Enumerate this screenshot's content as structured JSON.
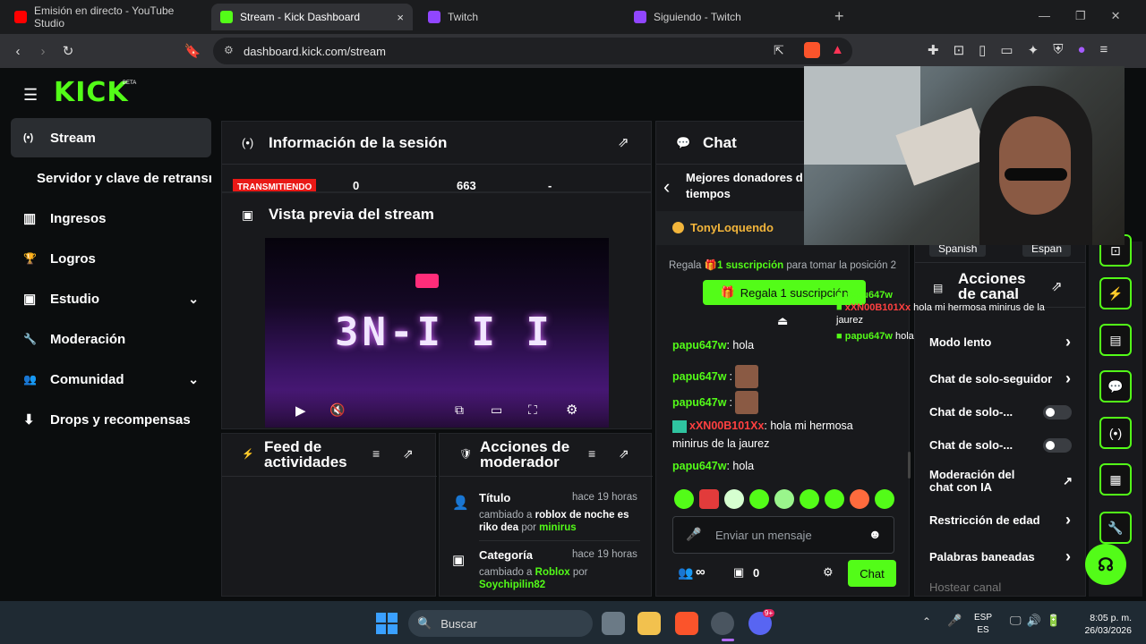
{
  "tabs": [
    {
      "title": "Emisión en directo - YouTube Studio",
      "favicon_color": "#ff0000"
    },
    {
      "title": "Stream - Kick Dashboard",
      "favicon_color": "#53fc18",
      "close": "×"
    },
    {
      "title": "Twitch",
      "favicon_color": "#9146ff"
    },
    {
      "title": "Siguiendo - Twitch",
      "favicon_color": "#9146ff"
    }
  ],
  "new_tab": "+",
  "address": {
    "url": "dashboard.kick.com/stream"
  },
  "logo": {
    "text": "KICK",
    "badge": "BETA"
  },
  "sidebar": [
    {
      "label": "Stream",
      "icon": "broadcast-icon",
      "glyph": "(•)"
    },
    {
      "label": "Servidor y clave de retransn",
      "icon": "",
      "glyph": ""
    },
    {
      "label": "Ingresos",
      "icon": "chart-icon",
      "glyph": "▥"
    },
    {
      "label": "Logros",
      "icon": "trophy-icon",
      "glyph": "🏆"
    },
    {
      "label": "Estudio",
      "icon": "studio-icon",
      "glyph": "▣",
      "chevron": "⌄"
    },
    {
      "label": "Moderación",
      "icon": "wrench-icon",
      "glyph": "🔧"
    },
    {
      "label": "Comunidad",
      "icon": "community-icon",
      "glyph": "👥",
      "chevron": "⌄"
    },
    {
      "label": "Drops y recompensas",
      "icon": "drops-icon",
      "glyph": "⬇"
    }
  ],
  "session": {
    "title": "Información de la sesión",
    "status": "TRANSMITIENDO",
    "stat1": "0",
    "stat2": "663",
    "stat3": "-"
  },
  "preview": {
    "title": "Vista previa del stream",
    "overlay_text": "3N-I I I"
  },
  "feed": {
    "title_line1": "Feed de",
    "title_line2": "actividades"
  },
  "modactions": {
    "title_line1": "Acciones de",
    "title_line2": "moderador",
    "items": [
      {
        "title": "Título",
        "time": "hace 19 horas",
        "changed": "cambiado a",
        "value": "roblox de noche es riko dea",
        "by": "por",
        "user": "minirus"
      },
      {
        "title": "Categoría",
        "time": "hace 19 horas",
        "changed": "cambiado a",
        "value": "Roblox",
        "by": "por",
        "user": "Soychipilin82"
      }
    ]
  },
  "chat": {
    "title": "Chat",
    "top_donors": "Mejores donadores de todos los tiempos",
    "top_donors_l1": "Mejores donadores d",
    "top_donors_l2": "tiempos",
    "top_user": "TonyLoquendo",
    "gift_pre": "Regala",
    "gift_link": "1 suscripción",
    "gift_post": "para tomar la posición 2",
    "gift_button": "Regala 1 suscripción",
    "messages": [
      {
        "user": "papu647w",
        "text": ": hola"
      },
      {
        "user": "papu647w",
        "text": ":"
      },
      {
        "user": "papu647w",
        "text": ":"
      },
      {
        "user": "xXN00B101Xx",
        "text": ": hola mi hermosa minirus de la jaurez"
      },
      {
        "user": "papu647w",
        "text": ": hola"
      }
    ],
    "input_placeholder": "Enviar un mensaje",
    "count_infinite": "∞",
    "count_box": "0",
    "send": "Chat"
  },
  "overlay_chat": [
    {
      "user": "papu647w",
      "text": ""
    },
    {
      "user": "xXN00B101Xx",
      "text": "hola mi hermosa minirus de la"
    },
    {
      "user": "",
      "text": "jaurez"
    },
    {
      "user": "papu647w",
      "text": "hola"
    }
  ],
  "channel": {
    "tags": [
      "Spanish",
      "Espan"
    ],
    "title_line1": "Acciones",
    "title_line2": "de canal",
    "rows": [
      {
        "label": "Modo lento",
        "control": "›"
      },
      {
        "label": "Chat de solo-seguidor",
        "control": "›"
      },
      {
        "label": "Chat de solo-...",
        "control": "toggle"
      },
      {
        "label": "Chat de solo-...",
        "control": "toggle"
      },
      {
        "label": "Moderación del chat con IA",
        "control": "↗"
      },
      {
        "label": "Restricción de edad",
        "control": "›"
      },
      {
        "label": "Palabras baneadas",
        "control": "›"
      },
      {
        "label": "Hostear canal",
        "control": ""
      }
    ]
  },
  "taskbar": {
    "search": "Buscar",
    "lang1": "ESP",
    "lang2": "ES",
    "time": "8:05 p. m.",
    "date": "26/03/2026",
    "badge": "9+"
  },
  "colors": {
    "accent": "#53fc18",
    "bg": "#0b0d0e",
    "panel": "#18191c",
    "live": "#e91916"
  }
}
